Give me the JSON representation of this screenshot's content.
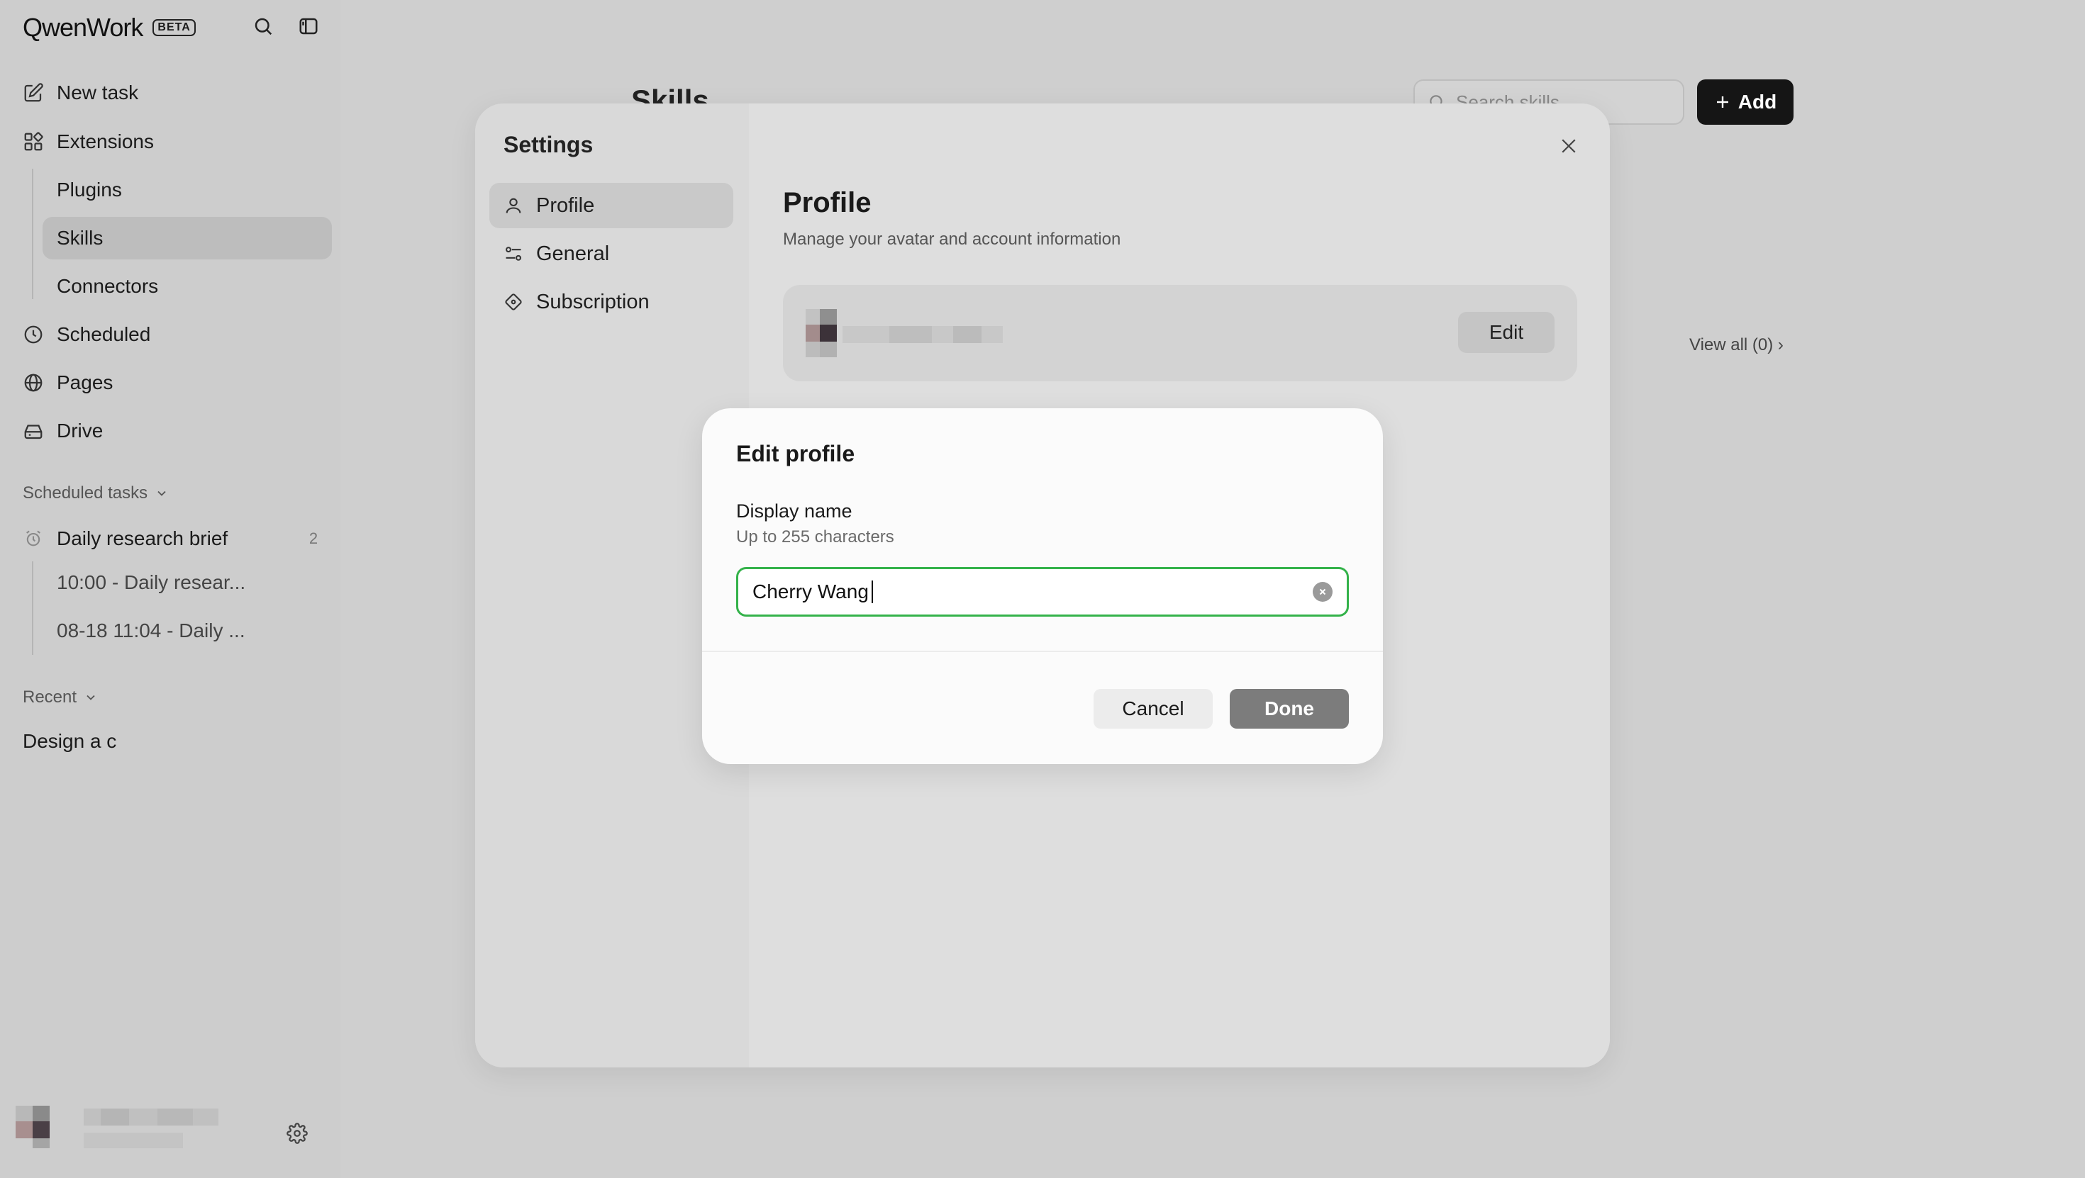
{
  "app": {
    "name": "QwenWork",
    "badge": "BETA"
  },
  "sidebar": {
    "new_task": "New task",
    "extensions": "Extensions",
    "plugins": "Plugins",
    "skills": "Skills",
    "connectors": "Connectors",
    "scheduled": "Scheduled",
    "pages": "Pages",
    "drive": "Drive",
    "scheduled_tasks_label": "Scheduled tasks",
    "scheduled_task": {
      "name": "Daily research brief",
      "count": "2",
      "runs": [
        "10:00 - Daily resear...",
        "08-18 11:04 - Daily ..."
      ]
    },
    "recent_label": "Recent",
    "recent_items": [
      "Design a c"
    ]
  },
  "main": {
    "title": "Skills",
    "search_placeholder": "Search skills",
    "add_label": "Add",
    "view_all": "View all (0) ›"
  },
  "settings": {
    "title": "Settings",
    "nav": [
      "Profile",
      "General",
      "Subscription"
    ],
    "active_nav": "Profile",
    "profile_heading": "Profile",
    "profile_subtitle": "Manage your avatar and account information",
    "edit_label": "Edit"
  },
  "edit_profile": {
    "title": "Edit profile",
    "field_label": "Display name",
    "field_hint": "Up to 255 characters",
    "display_name_value": "Cherry Wang",
    "cancel_label": "Cancel",
    "done_label": "Done"
  },
  "colors": {
    "focus_green": "#34b24a",
    "done_disabled": "#7c7c7c",
    "add_button": "#151515"
  }
}
